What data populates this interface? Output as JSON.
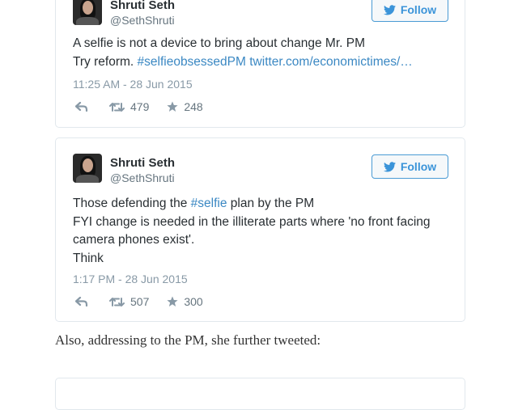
{
  "tweets": [
    {
      "author_name": "Shruti Seth",
      "handle": "@SethShruti",
      "follow_label": "Follow",
      "lines": [
        [
          {
            "text": "A selfie is not a device to bring about change Mr. PM"
          }
        ],
        [
          {
            "text": "Try reform. "
          },
          {
            "text": "#selfieobsessedPM",
            "link": true
          },
          {
            "text": "  "
          },
          {
            "text": "twitter.com/economictimes/…",
            "link": true
          }
        ]
      ],
      "timestamp": "11:25 AM - 28 Jun 2015",
      "retweets": "479",
      "likes": "248"
    },
    {
      "author_name": "Shruti Seth",
      "handle": "@SethShruti",
      "follow_label": "Follow",
      "lines": [
        [
          {
            "text": "Those defending the "
          },
          {
            "text": "#selfie",
            "link": true
          },
          {
            "text": " plan by the PM"
          }
        ],
        [
          {
            "text": "FYI change is needed in the illiterate parts where 'no front facing"
          }
        ],
        [
          {
            "text": "camera phones exist'."
          }
        ],
        [
          {
            "text": "Think"
          }
        ]
      ],
      "timestamp": "1:17 PM - 28 Jun 2015",
      "retweets": "507",
      "likes": "300"
    }
  ],
  "article": {
    "paragraph": "Also, addressing to the PM, she further tweeted:"
  },
  "colors": {
    "link": "#3b88c3",
    "follow_border": "#4a9bd4",
    "card_border": "#e1e8ed",
    "muted": "#8899a6"
  },
  "icons": [
    "twitter-bird-icon",
    "reply-icon",
    "retweet-icon",
    "like-star-icon"
  ]
}
